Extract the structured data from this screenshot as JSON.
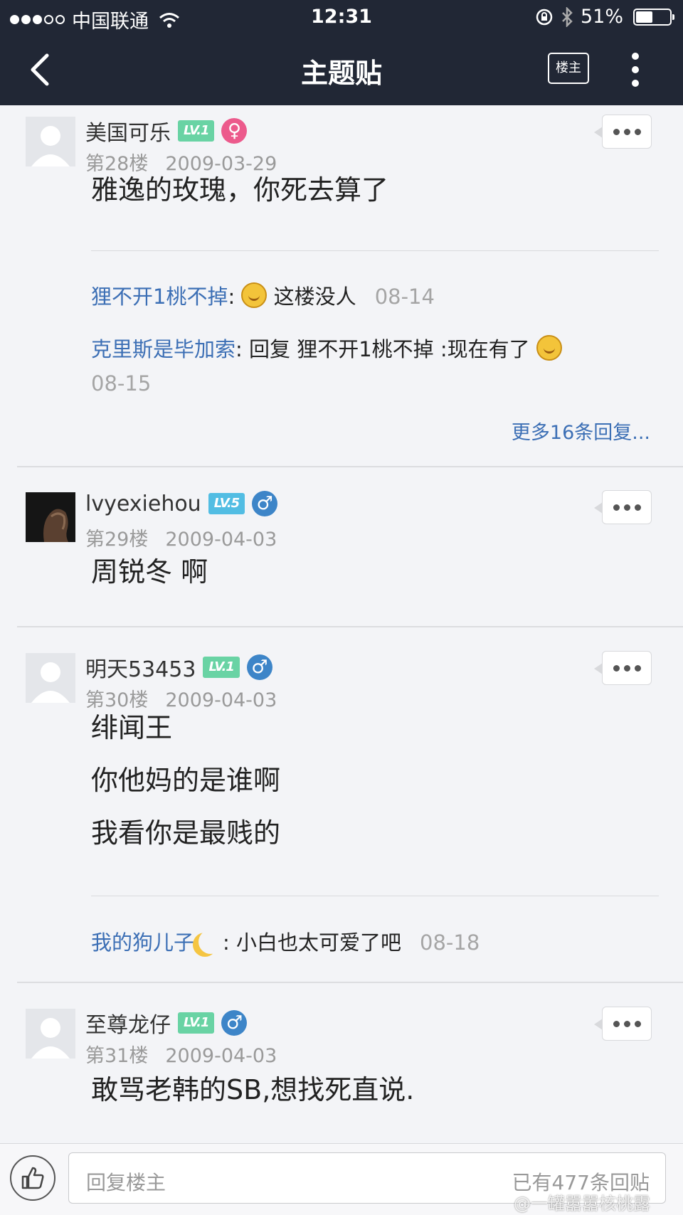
{
  "status_bar": {
    "carrier": "中国联通",
    "time": "12:31",
    "battery": "51%",
    "battery_level": 0.51
  },
  "nav": {
    "title": "主题贴",
    "op_button": "楼主"
  },
  "posts": [
    {
      "username": "美国可乐",
      "level": "LV.1",
      "gender": "female",
      "floor": "第28楼",
      "date": "2009-03-29",
      "lines": [
        "雅逸的玫瑰，你死去算了"
      ],
      "replies": [
        {
          "who": "狸不开1桃不掉",
          "sep": ":",
          "text": "这楼没人",
          "time": "08-14"
        },
        {
          "who": "克里斯是毕加索",
          "sep": ":",
          "text": "回复 狸不开1桃不掉 :现在有了",
          "time": "08-15"
        }
      ],
      "more_replies": "更多16条回复..."
    },
    {
      "username": "lvyexiehou",
      "level": "LV.5",
      "gender": "male",
      "floor": "第29楼",
      "date": "2009-04-03",
      "lines": [
        "周锐冬 啊"
      ]
    },
    {
      "username": "明天53453",
      "level": "LV.1",
      "gender": "male",
      "floor": "第30楼",
      "date": "2009-04-03",
      "lines": [
        "绯闻王",
        "你他妈的是谁啊",
        "我看你是最贱的"
      ],
      "replies": [
        {
          "who": "我的狗儿子",
          "sep": ":",
          "text": "小白也太可爱了吧",
          "time": "08-18"
        }
      ]
    },
    {
      "username": "至尊龙仔",
      "level": "LV.1",
      "gender": "male",
      "floor": "第31楼",
      "date": "2009-04-03",
      "lines": [
        "敢骂老韩的SB,想找死直说."
      ]
    }
  ],
  "bottom_bar": {
    "placeholder": "回复楼主",
    "reply_count": "已有477条回贴"
  },
  "watermark": "@一罐嚣嚣核桃露",
  "colors": {
    "nav_bg": "#212735",
    "link_blue": "#3c6fb5",
    "level_green": "#69d3a4",
    "level_blue": "#52bde3",
    "female": "#ec5a8c",
    "male": "#3d85c8"
  }
}
